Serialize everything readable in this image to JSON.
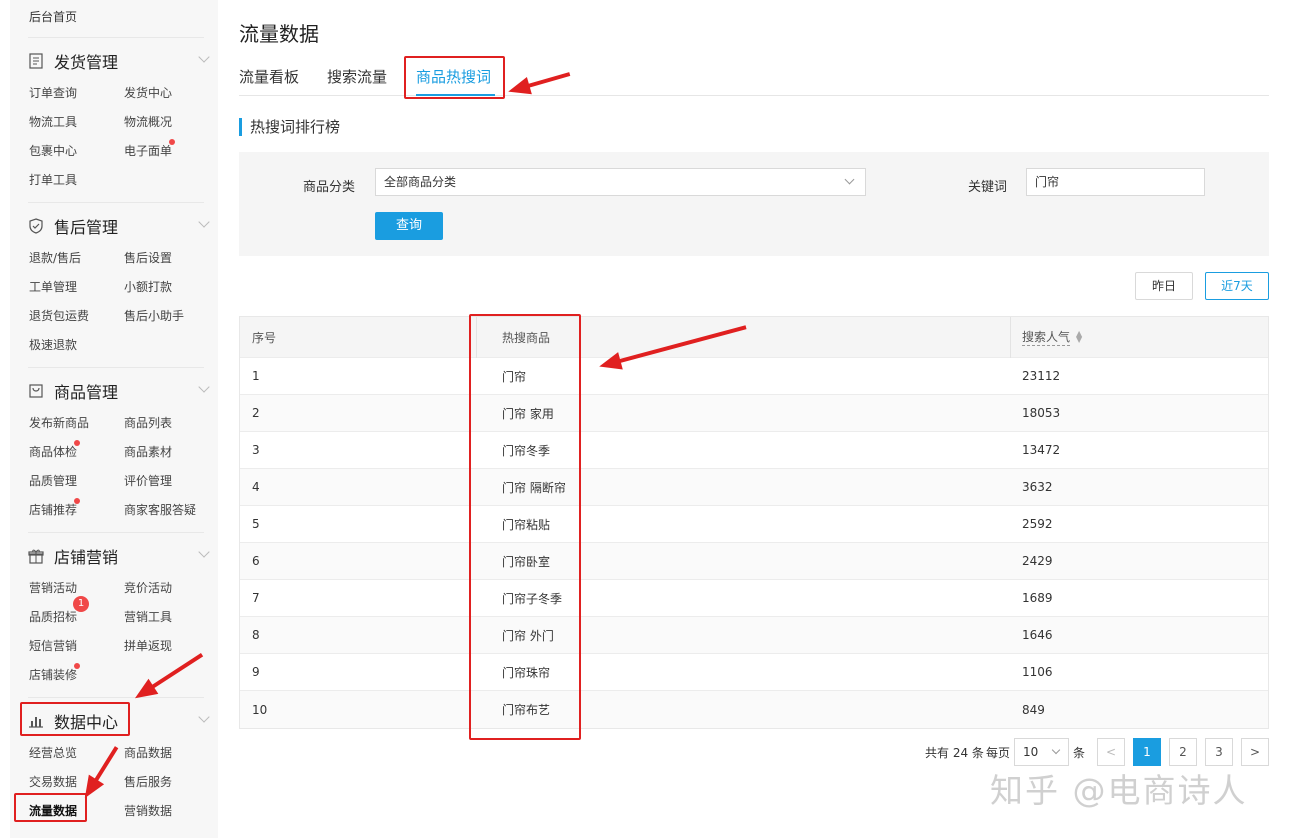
{
  "sidebar": {
    "home": "后台首页",
    "groups": [
      {
        "title": "发货管理",
        "icon": "list-icon",
        "items": [
          "订单查询",
          "发货中心",
          "物流工具",
          "物流概况",
          "包裹中心",
          "电子面单",
          "打单工具"
        ]
      },
      {
        "title": "售后管理",
        "icon": "shield-icon",
        "items": [
          "退款/售后",
          "售后设置",
          "工单管理",
          "小额打款",
          "退货包运费",
          "售后小助手",
          "极速退款"
        ]
      },
      {
        "title": "商品管理",
        "icon": "bag-icon",
        "items": [
          "发布新商品",
          "商品列表",
          "商品体检",
          "商品素材",
          "品质管理",
          "评价管理",
          "店铺推荐",
          "商家客服答疑"
        ]
      },
      {
        "title": "店铺营销",
        "icon": "gift-icon",
        "items": [
          "营销活动",
          "竞价活动",
          "品质招标",
          "营销工具",
          "短信营销",
          "拼单返现",
          "店铺装修"
        ],
        "badge": "1"
      },
      {
        "title": "数据中心",
        "icon": "bar-chart-icon",
        "items": [
          "经营总览",
          "商品数据",
          "交易数据",
          "售后服务",
          "流量数据",
          "营销数据"
        ]
      }
    ]
  },
  "main": {
    "title": "流量数据",
    "tabs": [
      "流量看板",
      "搜索流量",
      "商品热搜词"
    ],
    "active_tab": "商品热搜词",
    "section_title": "热搜词排行榜",
    "filter": {
      "category_label": "商品分类",
      "category_value": "全部商品分类",
      "keyword_label": "关键词",
      "keyword_value": "门帘",
      "query_button": "查询"
    },
    "date_buttons": [
      "昨日",
      "近7天"
    ],
    "table": {
      "headers": [
        "序号",
        "热搜商品",
        "搜索人气"
      ],
      "rows": [
        [
          "1",
          "门帘",
          "23112"
        ],
        [
          "2",
          "门帘 家用",
          "18053"
        ],
        [
          "3",
          "门帘冬季",
          "13472"
        ],
        [
          "4",
          "门帘 隔断帘",
          "3632"
        ],
        [
          "5",
          "门帘粘贴",
          "2592"
        ],
        [
          "6",
          "门帘卧室",
          "2429"
        ],
        [
          "7",
          "门帘子冬季",
          "1689"
        ],
        [
          "8",
          "门帘 外门",
          "1646"
        ],
        [
          "9",
          "门帘珠帘",
          "1106"
        ],
        [
          "10",
          "门帘布艺",
          "849"
        ]
      ]
    },
    "pagination": {
      "total_text": "共有 24 条",
      "per_page_label": "每页",
      "per_page_value": "10",
      "unit": "条",
      "prev": "<",
      "pages": [
        "1",
        "2",
        "3"
      ],
      "next": ">",
      "current": "1"
    }
  },
  "watermark": "知乎 @电商诗人",
  "colors": {
    "accent": "#1a9de0",
    "annotation": "#e02020"
  }
}
